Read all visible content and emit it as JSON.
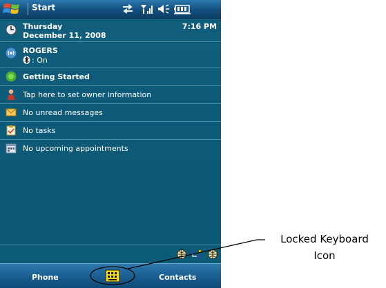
{
  "titlebar": {
    "title": "Start"
  },
  "today": {
    "clock": {
      "day": "Thursday",
      "date": "December 11, 2008",
      "time": "7:16 PM"
    },
    "network": {
      "name": "ROGERS",
      "bluetooth": ": On"
    },
    "getting_started": "Getting Started",
    "owner": "Tap here to set owner information",
    "messages": "No unread messages",
    "tasks": "No tasks",
    "appointments": "No upcoming appointments"
  },
  "softkeys": {
    "left": "Phone",
    "right": "Contacts"
  },
  "callout": {
    "line1": "Locked Keyboard",
    "line2": "Icon"
  },
  "colors": {
    "screen_bg": "#0c5c78",
    "titlebar": "#1a5e91",
    "separator": "#4a8ea8",
    "text": "#ffffff",
    "keyboard_icon": "#f2d81a"
  },
  "icons": {
    "titlebar": [
      "windows-flag-icon",
      "connectivity-icon",
      "signal-icon",
      "speaker-icon",
      "battery-icon"
    ],
    "rows": [
      "clock-icon",
      "wireless-icon",
      "bluetooth-icon",
      "getting-started-icon",
      "owner-icon",
      "messages-icon",
      "tasks-icon",
      "calendar-icon"
    ],
    "tray": [
      "globe-icon",
      "network-sync-icon",
      "globe-icon"
    ],
    "softkey_bar": [
      "locked-keyboard-icon"
    ]
  }
}
